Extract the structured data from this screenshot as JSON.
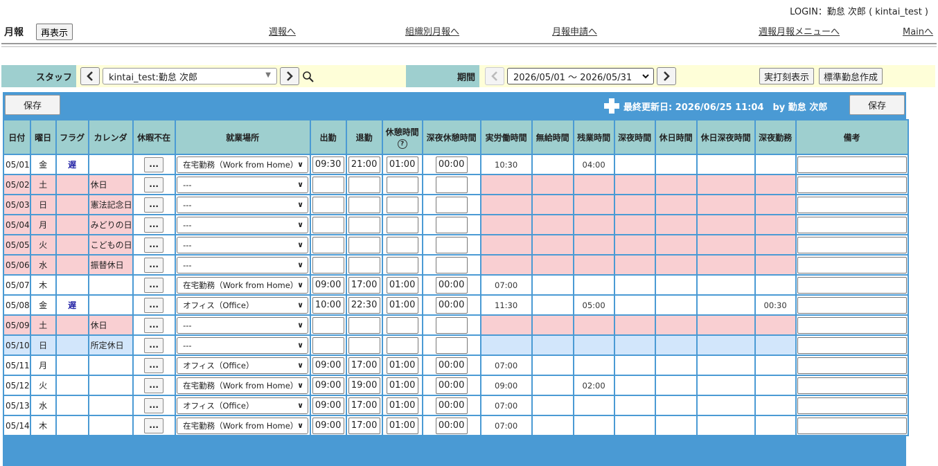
{
  "login": "LOGIN：勤怠 次郎 ( kintai_test )",
  "header": {
    "title": "月報",
    "reload": "再表示",
    "links": [
      "週報へ",
      "組織別月報へ",
      "月報申請へ",
      "週報月報メニューへ",
      "Mainへ"
    ]
  },
  "filter": {
    "staff_label": "スタッフ",
    "staff_value": "kintai_test:勤怠 次郎",
    "period_label": "期間",
    "period_value": "2026/05/01 ～ 2026/05/31",
    "actual_button": "実打刻表示",
    "standard_button": "標準勤怠作成"
  },
  "panel": {
    "save": "保存",
    "updated": "最終更新日: 2026/06/25 11:04　by 勤怠 次郎"
  },
  "columns": [
    "日付",
    "曜日",
    "フラグ",
    "カレンダ",
    "休暇不在",
    "就業場所",
    "出勤",
    "退勤",
    "休憩時間",
    "深夜休憩時間",
    "実労働時間",
    "無給時間",
    "残業時間",
    "深夜時間",
    "休日時間",
    "休日深夜時間",
    "深夜勤務",
    "備考"
  ],
  "help_glyph": "?",
  "dots": "...",
  "rows": [
    {
      "date": "05/01",
      "dow": "金",
      "flag": "遅",
      "cal": "",
      "place": "在宅勤務（Work from Home）",
      "in": "09:30",
      "out": "21:00",
      "brk": "01:00",
      "nbrk": "00:00",
      "work": "10:30",
      "unpaid": "",
      "ot": "04:00",
      "night": "",
      "hol": "",
      "holnight": "",
      "nightwork": "",
      "kind": "normal"
    },
    {
      "date": "05/02",
      "dow": "土",
      "flag": "",
      "cal": "休日",
      "place": "---",
      "in": "",
      "out": "",
      "brk": "",
      "nbrk": "",
      "work": "",
      "unpaid": "",
      "ot": "",
      "night": "",
      "hol": "",
      "holnight": "",
      "nightwork": "",
      "kind": "hol"
    },
    {
      "date": "05/03",
      "dow": "日",
      "flag": "",
      "cal": "憲法記念日",
      "place": "---",
      "in": "",
      "out": "",
      "brk": "",
      "nbrk": "",
      "work": "",
      "unpaid": "",
      "ot": "",
      "night": "",
      "hol": "",
      "holnight": "",
      "nightwork": "",
      "kind": "hol"
    },
    {
      "date": "05/04",
      "dow": "月",
      "flag": "",
      "cal": "みどりの日",
      "place": "---",
      "in": "",
      "out": "",
      "brk": "",
      "nbrk": "",
      "work": "",
      "unpaid": "",
      "ot": "",
      "night": "",
      "hol": "",
      "holnight": "",
      "nightwork": "",
      "kind": "hol"
    },
    {
      "date": "05/05",
      "dow": "火",
      "flag": "",
      "cal": "こどもの日",
      "place": "---",
      "in": "",
      "out": "",
      "brk": "",
      "nbrk": "",
      "work": "",
      "unpaid": "",
      "ot": "",
      "night": "",
      "hol": "",
      "holnight": "",
      "nightwork": "",
      "kind": "hol"
    },
    {
      "date": "05/06",
      "dow": "水",
      "flag": "",
      "cal": "振替休日",
      "place": "---",
      "in": "",
      "out": "",
      "brk": "",
      "nbrk": "",
      "work": "",
      "unpaid": "",
      "ot": "",
      "night": "",
      "hol": "",
      "holnight": "",
      "nightwork": "",
      "kind": "hol"
    },
    {
      "date": "05/07",
      "dow": "木",
      "flag": "",
      "cal": "",
      "place": "在宅勤務（Work from Home）",
      "in": "09:00",
      "out": "17:00",
      "brk": "01:00",
      "nbrk": "00:00",
      "work": "07:00",
      "unpaid": "",
      "ot": "",
      "night": "",
      "hol": "",
      "holnight": "",
      "nightwork": "",
      "kind": "normal"
    },
    {
      "date": "05/08",
      "dow": "金",
      "flag": "遅",
      "cal": "",
      "place": "オフィス（Office）",
      "in": "10:00",
      "out": "22:30",
      "brk": "01:00",
      "nbrk": "00:00",
      "work": "11:30",
      "unpaid": "",
      "ot": "05:00",
      "night": "",
      "hol": "",
      "holnight": "",
      "nightwork": "00:30",
      "kind": "normal"
    },
    {
      "date": "05/09",
      "dow": "土",
      "flag": "",
      "cal": "休日",
      "place": "---",
      "in": "",
      "out": "",
      "brk": "",
      "nbrk": "",
      "work": "",
      "unpaid": "",
      "ot": "",
      "night": "",
      "hol": "",
      "holnight": "",
      "nightwork": "",
      "kind": "hol"
    },
    {
      "date": "05/10",
      "dow": "日",
      "flag": "",
      "cal": "所定休日",
      "place": "---",
      "in": "",
      "out": "",
      "brk": "",
      "nbrk": "",
      "work": "",
      "unpaid": "",
      "ot": "",
      "night": "",
      "hol": "",
      "holnight": "",
      "nightwork": "",
      "kind": "spec"
    },
    {
      "date": "05/11",
      "dow": "月",
      "flag": "",
      "cal": "",
      "place": "オフィス（Office）",
      "in": "09:00",
      "out": "17:00",
      "brk": "01:00",
      "nbrk": "00:00",
      "work": "07:00",
      "unpaid": "",
      "ot": "",
      "night": "",
      "hol": "",
      "holnight": "",
      "nightwork": "",
      "kind": "normal"
    },
    {
      "date": "05/12",
      "dow": "火",
      "flag": "",
      "cal": "",
      "place": "在宅勤務（Work from Home）",
      "in": "09:00",
      "out": "19:00",
      "brk": "01:00",
      "nbrk": "00:00",
      "work": "09:00",
      "unpaid": "",
      "ot": "02:00",
      "night": "",
      "hol": "",
      "holnight": "",
      "nightwork": "",
      "kind": "normal"
    },
    {
      "date": "05/13",
      "dow": "水",
      "flag": "",
      "cal": "",
      "place": "オフィス（Office）",
      "in": "09:00",
      "out": "17:00",
      "brk": "01:00",
      "nbrk": "00:00",
      "work": "07:00",
      "unpaid": "",
      "ot": "",
      "night": "",
      "hol": "",
      "holnight": "",
      "nightwork": "",
      "kind": "normal"
    },
    {
      "date": "05/14",
      "dow": "木",
      "flag": "",
      "cal": "",
      "place": "在宅勤務（Work from Home）",
      "in": "09:00",
      "out": "17:00",
      "brk": "01:00",
      "nbrk": "00:00",
      "work": "07:00",
      "unpaid": "",
      "ot": "",
      "night": "",
      "hol": "",
      "holnight": "",
      "nightwork": "",
      "kind": "normal"
    }
  ]
}
